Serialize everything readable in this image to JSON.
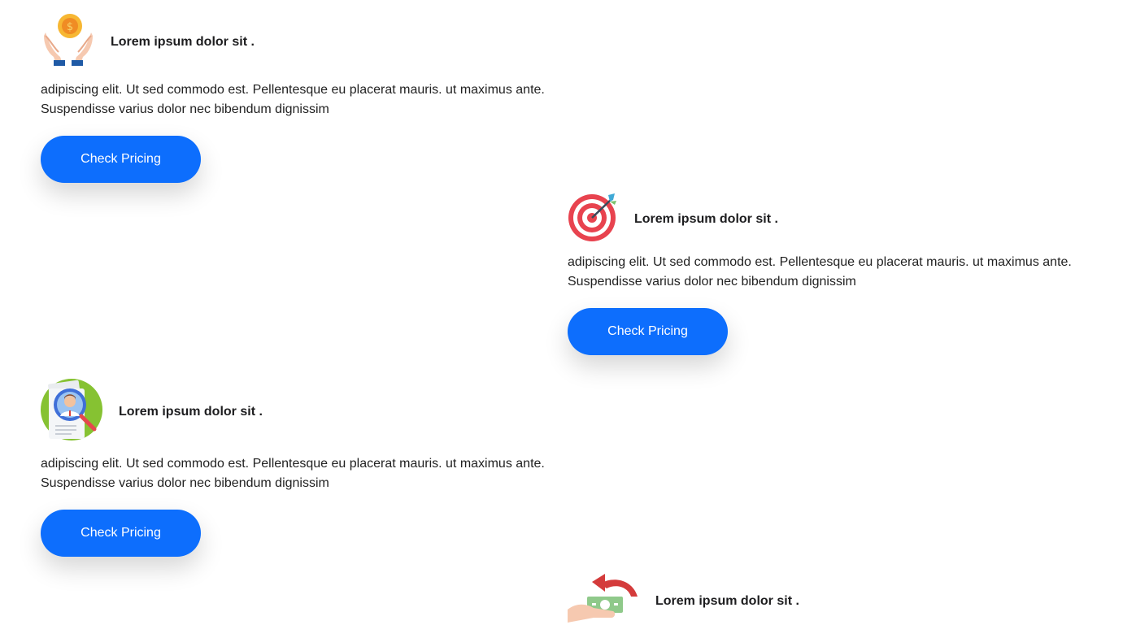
{
  "cards": [
    {
      "icon": "hands-coin-icon",
      "title": "Lorem ipsum dolor sit .",
      "text": "adipiscing elit. Ut sed commodo est. Pellentesque eu placerat mauris. ut maximus ante. Suspendisse varius dolor nec bibendum dignissim",
      "button_label": "Check Pricing"
    },
    {
      "icon": "target-dart-icon",
      "title": "Lorem ipsum dolor sit .",
      "text": "adipiscing elit. Ut sed commodo est. Pellentesque eu placerat mauris. ut maximus ante. Suspendisse varius dolor nec bibendum dignissim",
      "button_label": "Check Pricing"
    },
    {
      "icon": "candidate-search-icon",
      "title": "Lorem ipsum dolor sit .",
      "text": "adipiscing elit. Ut sed commodo est. Pellentesque eu placerat mauris. ut maximus ante. Suspendisse varius dolor nec bibendum dignissim",
      "button_label": "Check Pricing"
    },
    {
      "icon": "money-refund-icon",
      "title": "Lorem ipsum dolor sit ."
    }
  ],
  "colors": {
    "button": "#0d6efd",
    "button_text": "#ffffff",
    "title": "#1d1d1f"
  }
}
